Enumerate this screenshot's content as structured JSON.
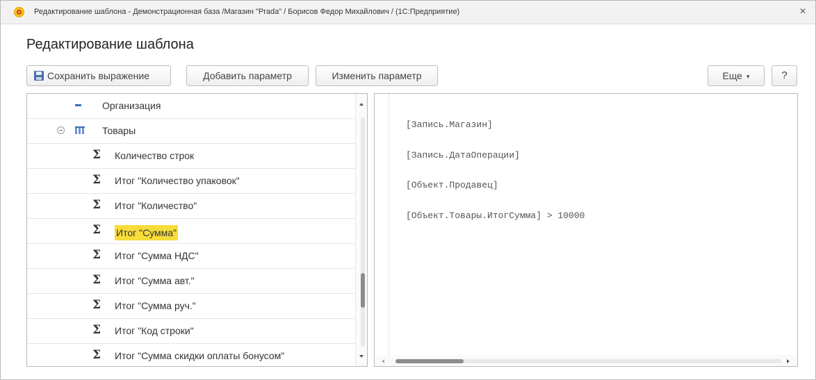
{
  "window": {
    "title": "Редактирование шаблона - Демонстрационная база /Магазин \"Prada\" / Борисов Федор Михайлович / (1С:Предприятие)",
    "close_glyph": "×"
  },
  "form": {
    "title": "Редактирование шаблона"
  },
  "toolbar": {
    "save_label": "Сохранить выражение",
    "add_param_label": "Добавить параметр",
    "change_param_label": "Изменить параметр",
    "more_label": "Еще",
    "more_caret": "▾",
    "help_label": "?"
  },
  "tree": {
    "items": [
      {
        "label": "Организация",
        "icon": "dash-icon"
      },
      {
        "label": "Товары",
        "icon": "table-icon",
        "expanded": true
      },
      {
        "label": "Количество строк",
        "icon": "sigma-icon",
        "symbol": "Σ"
      },
      {
        "label": "Итог \"Количество упаковок\"",
        "icon": "sigma-icon",
        "symbol": "Σ"
      },
      {
        "label": "Итог \"Количество\"",
        "icon": "sigma-icon",
        "symbol": "Σ"
      },
      {
        "label": "Итог \"Сумма\"",
        "icon": "sigma-icon",
        "symbol": "Σ",
        "selected": true
      },
      {
        "label": "Итог \"Сумма НДС\"",
        "icon": "sigma-icon",
        "symbol": "Σ"
      },
      {
        "label": "Итог \"Сумма авт.\"",
        "icon": "sigma-icon",
        "symbol": "Σ"
      },
      {
        "label": "Итог \"Сумма руч.\"",
        "icon": "sigma-icon",
        "symbol": "Σ"
      },
      {
        "label": "Итог \"Код строки\"",
        "icon": "sigma-icon",
        "symbol": "Σ"
      },
      {
        "label": "Итог \"Сумма скидки оплаты бонусом\"",
        "icon": "sigma-icon",
        "symbol": "Σ"
      }
    ]
  },
  "editor": {
    "lines": [
      "[Запись.Магазин]",
      "[Запись.ДатаОперации]",
      "[Объект.Продавец]",
      "[Объект.Товары.ИтогСумма] > 10000"
    ]
  },
  "colors": {
    "selection_highlight": "#f7dc3a",
    "icon_blue": "#3c6eb4"
  }
}
